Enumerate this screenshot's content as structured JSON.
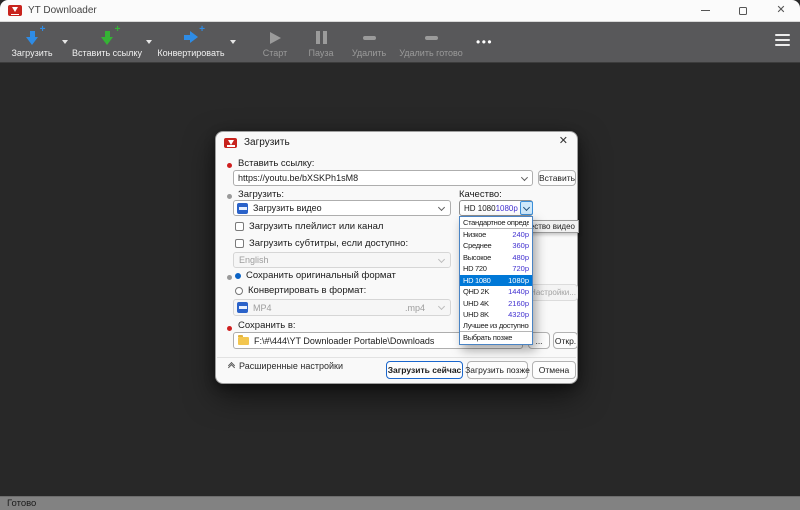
{
  "window": {
    "title": "YT Downloader"
  },
  "toolbar": {
    "items": [
      {
        "label": "Загрузить",
        "icon": "download-arrow-plus-icon",
        "color": "#2e8ce6",
        "enabled": true,
        "has_menu": true
      },
      {
        "label": "Вставить ссылку",
        "icon": "paste-link-arrow-plus-icon",
        "color": "#35b335",
        "enabled": true,
        "has_menu": true
      },
      {
        "label": "Конвертировать",
        "icon": "convert-arrow-plus-icon",
        "color": "#2e8ce6",
        "enabled": true,
        "has_menu": true
      },
      {
        "label": "Старт",
        "icon": "play-icon",
        "enabled": false
      },
      {
        "label": "Пауза",
        "icon": "pause-icon",
        "enabled": false
      },
      {
        "label": "Удалить",
        "icon": "minus-icon",
        "enabled": false
      },
      {
        "label": "Удалить готово",
        "icon": "minus-icon",
        "enabled": false
      }
    ],
    "more_label": "•••"
  },
  "dialog": {
    "title": "Загрузить",
    "paste_link": {
      "label": "Вставить ссылку:",
      "url": "https://youtu.be/bXSKPh1sM8",
      "paste_button": "Вставить"
    },
    "download_section": {
      "label": "Загрузить:",
      "mode_value": "Загрузить видео",
      "playlist_checkbox": "Загрузить плейлист или канал",
      "subtitles_checkbox": "Загрузить субтитры, если доступно:",
      "language_value": "English"
    },
    "quality": {
      "label": "Качество:",
      "selected_name": "HD 1080",
      "selected_value": "1080p",
      "tooltip": "Качество видео",
      "options": [
        {
          "name": "Стандартное определение",
          "value": "",
          "divider_after": true
        },
        {
          "name": "Низкое",
          "value": "240p"
        },
        {
          "name": "Среднее",
          "value": "360p"
        },
        {
          "name": "Высокое",
          "value": "480p"
        },
        {
          "name": "HD 720",
          "value": "720p"
        },
        {
          "name": "HD 1080",
          "value": "1080p",
          "selected": true
        },
        {
          "name": "QHD 2K",
          "value": "1440p"
        },
        {
          "name": "UHD 4K",
          "value": "2160p"
        },
        {
          "name": "UHD 8K",
          "value": "4320p"
        },
        {
          "name": "Лучшее из доступного",
          "value": "",
          "divider_after": true
        },
        {
          "name": "Выбрать позже",
          "value": ""
        }
      ]
    },
    "format_section": {
      "keep_original": "Сохранить оригинальный формат",
      "convert_to": "Конвертировать в формат:",
      "format_value": "MP4",
      "format_ext": ".mp4",
      "settings_button": "Настройки..."
    },
    "save_section": {
      "label": "Сохранить в:",
      "path": "F:\\#\\444\\YT Downloader Portable\\Downloads",
      "browse_button": "...",
      "open_button": "Откр."
    },
    "footer": {
      "advanced_label": "Расширенные настройки",
      "download_now": "Загрузить сейчас",
      "download_later": "Загрузить позже",
      "cancel": "Отмена"
    }
  },
  "statusbar": {
    "text": "Готово"
  },
  "colors": {
    "accent": "#0078d7",
    "quality_value": "#4130d0",
    "toolbar_bg": "#58585a",
    "content_bg": "#282828"
  }
}
